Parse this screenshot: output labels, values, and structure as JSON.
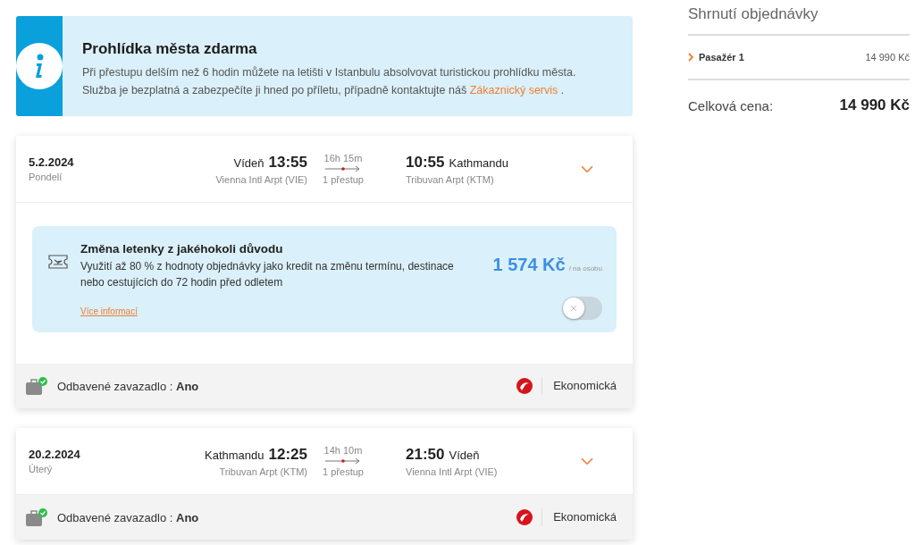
{
  "info_banner": {
    "title": "Prohlídka města zdarma",
    "text": "Při přestupu delším než 6 hodin můžete na letišti v Istanbulu absolvovat turistickou prohlídku města. Služba je bezplatná a zabezpečíte ji hned po příletu, případně kontaktujte náš",
    "link": "Zákaznický servis",
    "end": "."
  },
  "flights": [
    {
      "date": "5.2.2024",
      "weekday": "Pondelí",
      "from_city": "Vídeň",
      "dep_time": "13:55",
      "from_airport": "Vienna Intl Arpt (VIE)",
      "duration": "16h 15m",
      "stops": "1 přestup",
      "arr_time": "10:55",
      "to_city": "Kathmandu",
      "to_airport": "Tribuvan Arpt (KTM)",
      "addon": {
        "title": "Změna letenky z jakéhokoli důvodu",
        "text": "Využití až 80 % z hodnoty objednávky jako kredit na změnu termínu, destinace nebo cestujících do 72 hodin před odletem",
        "price": "1 574 Kč",
        "per": "/ na osobu",
        "link": "Více informací",
        "on": false
      },
      "baggage_label": "Odbavené zavazadlo :",
      "baggage_value": "Ano",
      "cabin": "Ekonomická"
    },
    {
      "date": "20.2.2024",
      "weekday": "Úterý",
      "from_city": "Kathmandu",
      "dep_time": "12:25",
      "from_airport": "Tribuvan Arpt (KTM)",
      "duration": "14h 10m",
      "stops": "1 přestup",
      "arr_time": "21:50",
      "to_city": "Vídeň",
      "to_airport": "Vienna Intl Arpt (VIE)",
      "baggage_label": "Odbavené zavazadlo :",
      "baggage_value": "Ano",
      "cabin": "Ekonomická"
    }
  ],
  "summary": {
    "title": "Shrnutí objednávky",
    "items": [
      {
        "label": "Pasažér 1",
        "price": "14 990 Kč"
      }
    ],
    "total_label": "Celková cena:",
    "total": "14 990 Kč"
  }
}
